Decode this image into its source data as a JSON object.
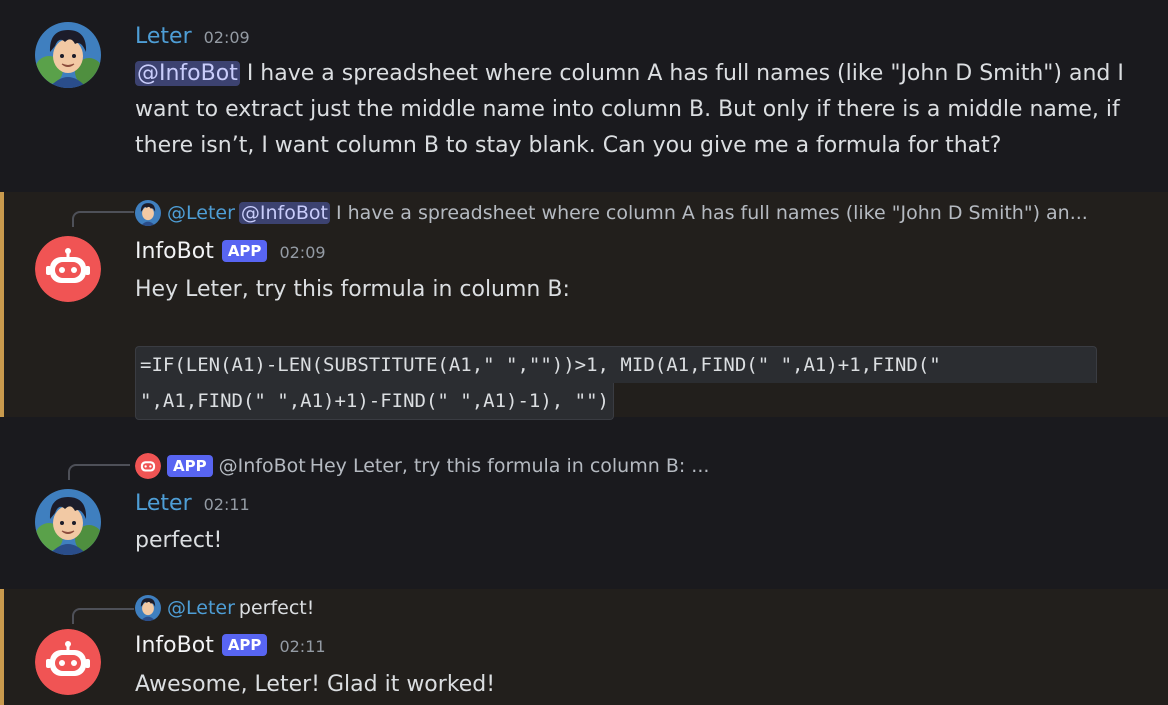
{
  "messages": [
    {
      "author": "Leter",
      "time": "02:09",
      "mention": "@InfoBot",
      "text": " I have a spreadsheet where column A has full names (like \"John D Smith\") and I want to extract just the middle name into column B. But only if there is a middle name, if there isn’t, I want column B to stay blank. Can you give me a formula for that?"
    },
    {
      "author": "InfoBot",
      "badge": "APP",
      "time": "02:09",
      "reply": {
        "author": "@Leter",
        "mention": "@InfoBot",
        "text": "I have a spreadsheet where column A has full names (like \"John D Smith\") an..."
      },
      "text": "Hey Leter, try this formula in column B:",
      "code_line_1": "=IF(LEN(A1)-LEN(SUBSTITUTE(A1,\" \",\"\"))>1, MID(A1,FIND(\" \",A1)+1,FIND(\"",
      "code_line_2": "\",A1,FIND(\" \",A1)+1)-FIND(\" \",A1)-1), \"\")"
    },
    {
      "author": "Leter",
      "time": "02:11",
      "reply": {
        "badge": "APP",
        "author": "@InfoBot",
        "text": "Hey Leter, try this formula in column B:  ..."
      },
      "text": "perfect!"
    },
    {
      "author": "InfoBot",
      "badge": "APP",
      "time": "02:11",
      "reply": {
        "author": "@Leter",
        "text": "perfect!"
      },
      "text": "Awesome, Leter! Glad it worked!"
    }
  ],
  "icons": {
    "user_avatar": "anime-boy-avatar-icon",
    "bot_avatar": "robot-face-icon"
  },
  "colors": {
    "background": "#1a1a1e",
    "highlight_bg": "#221f1c",
    "highlight_border": "#c99a4d",
    "user_name": "#4e9ed6",
    "bot_avatar_bg": "#f05454",
    "badge_bg": "#5865f2",
    "mention_bg": "#3c4270"
  }
}
